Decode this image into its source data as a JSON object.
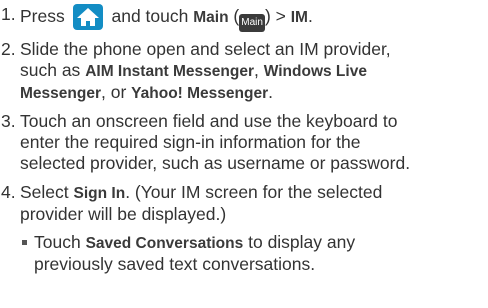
{
  "steps": [
    {
      "number": "1.",
      "text_a": "Press",
      "text_b": "and touch",
      "main_label": "Main",
      "paren_open": "(",
      "main_key": "Main",
      "paren_close": ") >",
      "im_label": "IM",
      "period": ".",
      "icon": "home-icon"
    },
    {
      "number": "2.",
      "line1": "Slide the phone open and select an IM provider,",
      "line2_a": "such as",
      "aim": "AIM Instant Messenger",
      "line2_b": ",",
      "wlm": "Windows Live",
      "wlm2": "Messenger",
      "line3_b": ", or",
      "yahoo": "Yahoo! Messenger",
      "line3_c": "."
    },
    {
      "number": "3.",
      "line1": "Touch an onscreen field and use the keyboard to",
      "line2": "enter the required sign-in information for the",
      "line3": "selected provider, such as username or password."
    },
    {
      "number": "4.",
      "line1_a": "Select",
      "sign_in": "Sign In",
      "line1_b": ". (Your IM screen for the selected",
      "line2": "provider will be displayed.)"
    }
  ],
  "bullet": {
    "line1_a": "Touch",
    "saved": "Saved Conversations",
    "line1_b": "to display any",
    "line2": "previously saved text conversations."
  },
  "colors": {
    "icon_bg": "#138dc4",
    "text": "#333333",
    "key_bg": "#3b3b3b"
  }
}
